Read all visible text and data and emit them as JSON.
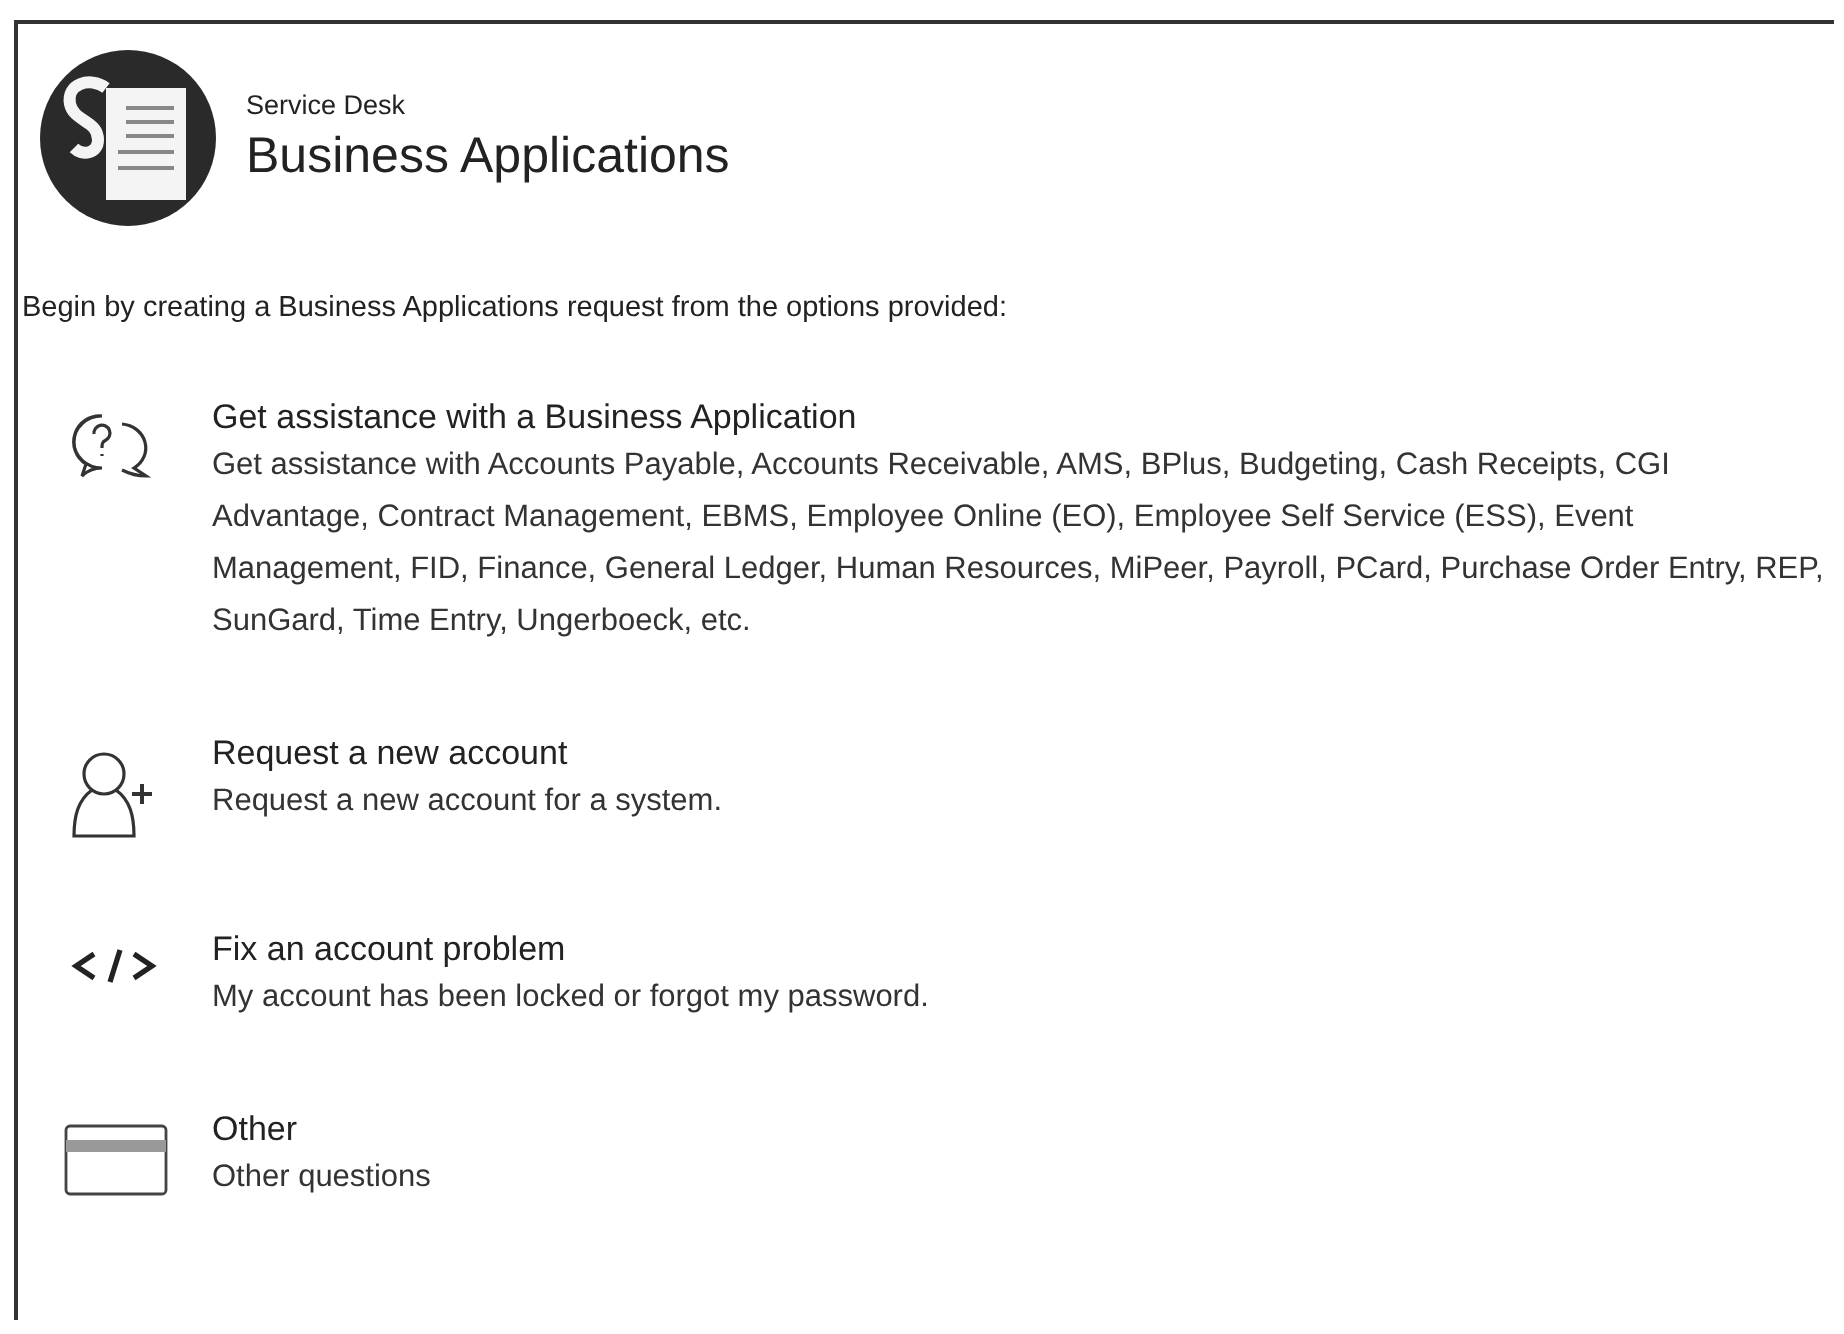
{
  "header": {
    "subtitle": "Service Desk",
    "title": "Business Applications"
  },
  "intro": "Begin by creating a Business Applications request from the options provided:",
  "options": [
    {
      "kind": "chat",
      "title": "Get assistance with a Business Application",
      "description": "Get assistance with Accounts Payable, Accounts Receivable, AMS, BPlus, Budgeting, Cash Receipts, CGI Advantage, Contract Management, EBMS, Employee Online (EO), Employee Self Service (ESS), Event Management, FID, Finance, General Ledger, Human Resources, MiPeer, Payroll, PCard, Purchase Order Entry, REP, SunGard, Time Entry, Ungerboeck, etc."
    },
    {
      "kind": "user-add",
      "title": "Request a new account",
      "description": "Request a new account for a system."
    },
    {
      "kind": "code",
      "title": "Fix an account problem",
      "description": "My account has been locked or forgot my password."
    },
    {
      "kind": "card",
      "title": "Other",
      "description": "Other questions"
    }
  ]
}
